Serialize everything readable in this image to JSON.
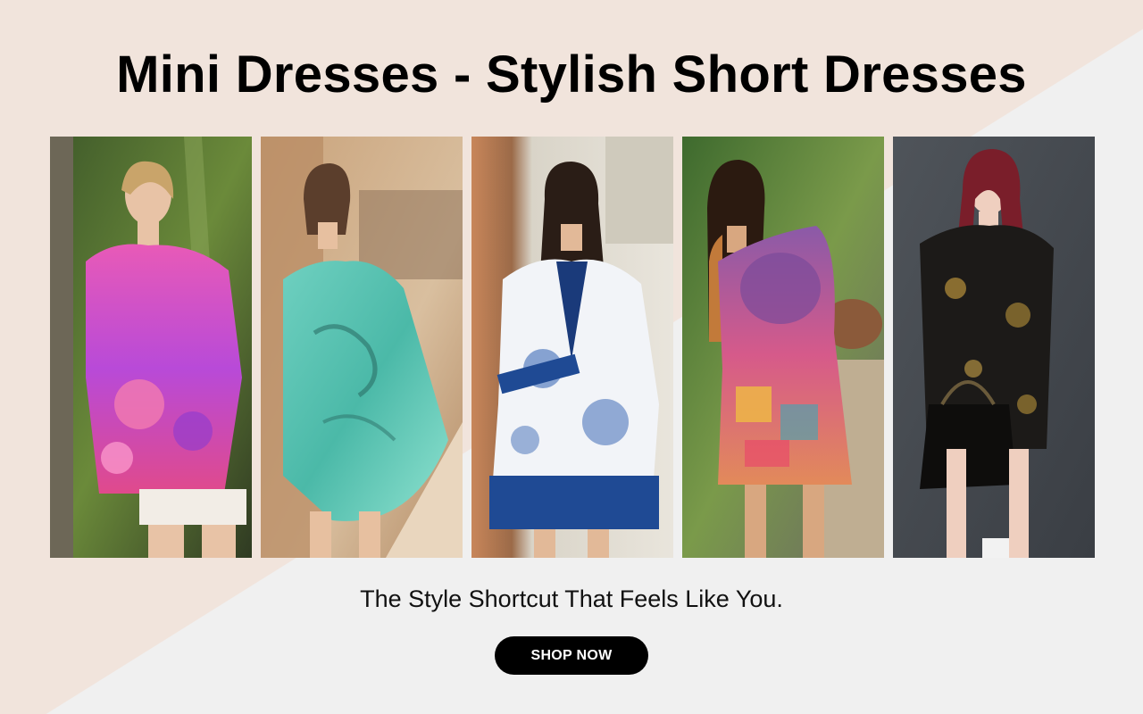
{
  "hero": {
    "title": "Mini Dresses - Stylish Short Dresses",
    "tagline": "The Style Shortcut That Feels Like You.",
    "cta_label": "SHOP NOW"
  },
  "colors": {
    "background_light": "#f0f0f0",
    "background_blush": "#f1e4dc",
    "cta_background": "#000000",
    "cta_text": "#ffffff"
  },
  "gallery": {
    "photos": [
      {
        "name": "model-pink-floral-top"
      },
      {
        "name": "model-turquoise-tropical-dress"
      },
      {
        "name": "model-blue-white-porcelain-dress"
      },
      {
        "name": "model-patchwork-kaftan-dress"
      },
      {
        "name": "model-black-gold-paisley-dress"
      }
    ]
  }
}
